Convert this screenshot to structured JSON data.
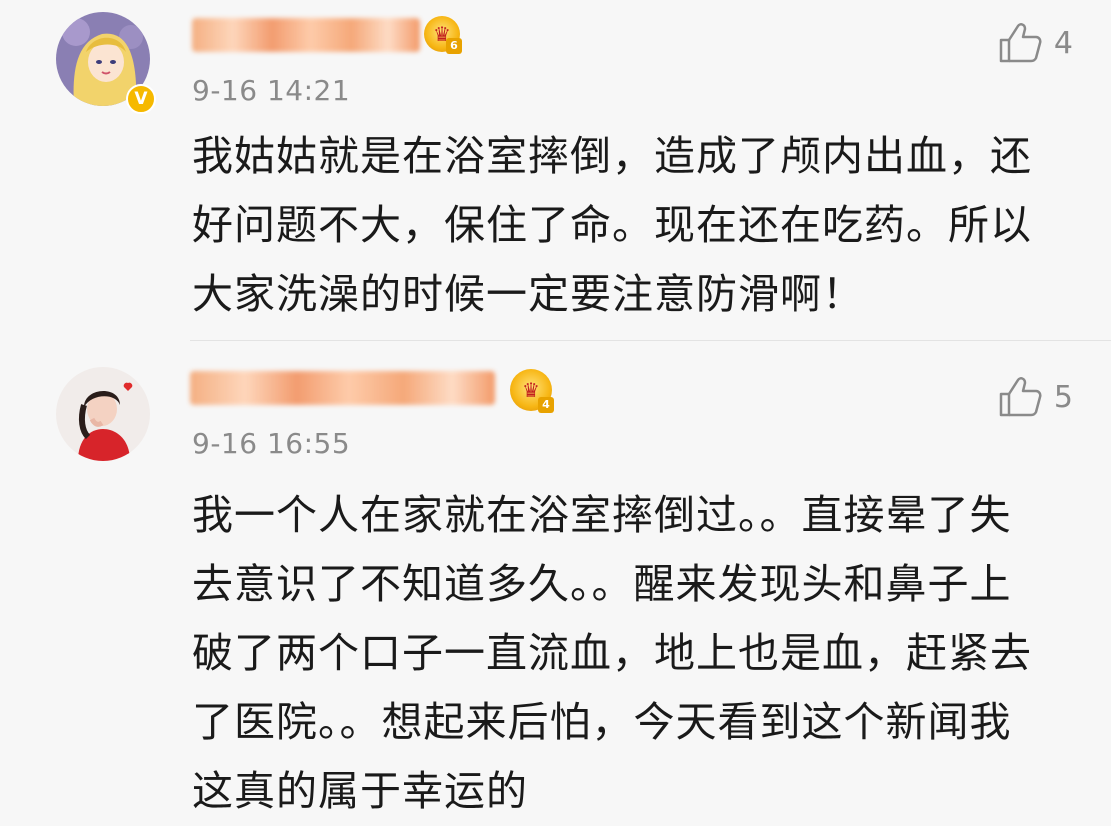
{
  "comments": [
    {
      "time": "9-16 14:21",
      "likes": "4",
      "verified": true,
      "verified_badge": "V",
      "level_badge": "6",
      "content": "我姑姑就是在浴室摔倒，造成了颅内出血，还\n好问题不大，保住了命。现在还在吃药。所以\n大家洗澡的时候一定要注意防滑啊！"
    },
    {
      "time": "9-16 16:55",
      "likes": "5",
      "verified": false,
      "level_badge": "4",
      "content": "我一个人在家就在浴室摔倒过。。直接晕了失\n去意识了不知道多久。。醒来发现头和鼻子上\n破了两个口子一直流血，地上也是血，赶紧去\n了医院。。想起来后怕，今天看到这个新闻我\n这真的属于幸运的"
    }
  ],
  "colors": {
    "background": "#f7f7f7",
    "meta_text": "#8a8a8a",
    "body_text": "#1a1a1a",
    "verified_badge": "#f6b900"
  },
  "icons": {
    "like": "thumbs-up-icon",
    "member": "crown-icon"
  }
}
